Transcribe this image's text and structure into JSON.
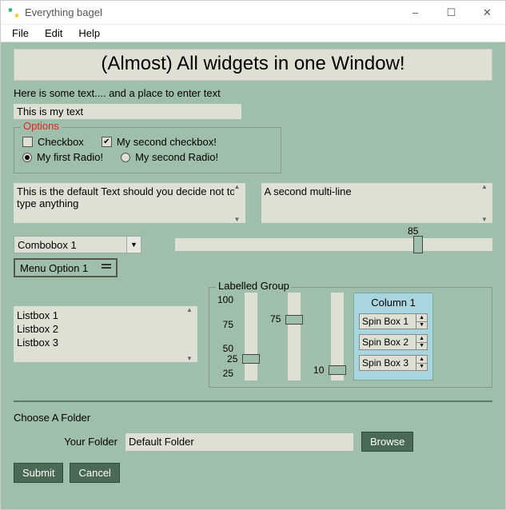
{
  "window": {
    "title": "Everything bagel",
    "minimize": "–",
    "maximize": "☐",
    "close": "✕"
  },
  "menu": {
    "file": "File",
    "edit": "Edit",
    "help": "Help"
  },
  "header": "(Almost) All widgets in one Window!",
  "intro": "Here is some text.... and a place to enter text",
  "input1_value": "This is my text",
  "options": {
    "legend": "Options",
    "cb1": "Checkbox",
    "cb1_checked": false,
    "cb2": "My second checkbox!",
    "cb2_checked": true,
    "rb1": "My first Radio!",
    "rb2": "My second Radio!",
    "rb_selected": 1
  },
  "ml1": "This is the default Text should you decide not to type anything",
  "ml2": "A second multi-line",
  "combo": {
    "value": "Combobox 1"
  },
  "hslider": {
    "value": 85
  },
  "menuopt": "Menu Option 1",
  "listbox": [
    "Listbox 1",
    "Listbox 2",
    "Listbox 3"
  ],
  "labelled_group": {
    "legend": "Labelled Group",
    "ticks": [
      "100",
      "75",
      "50",
      "25"
    ],
    "s1": {
      "value": 25
    },
    "s2": {
      "value": 75
    },
    "s3": {
      "value": 10
    },
    "col_title": "Column 1",
    "spins": [
      "Spin Box 1",
      "Spin Box 2",
      "Spin Box 3"
    ]
  },
  "folder": {
    "heading": "Choose A Folder",
    "label": "Your Folder",
    "value": "Default Folder",
    "browse": "Browse"
  },
  "buttons": {
    "submit": "Submit",
    "cancel": "Cancel"
  }
}
